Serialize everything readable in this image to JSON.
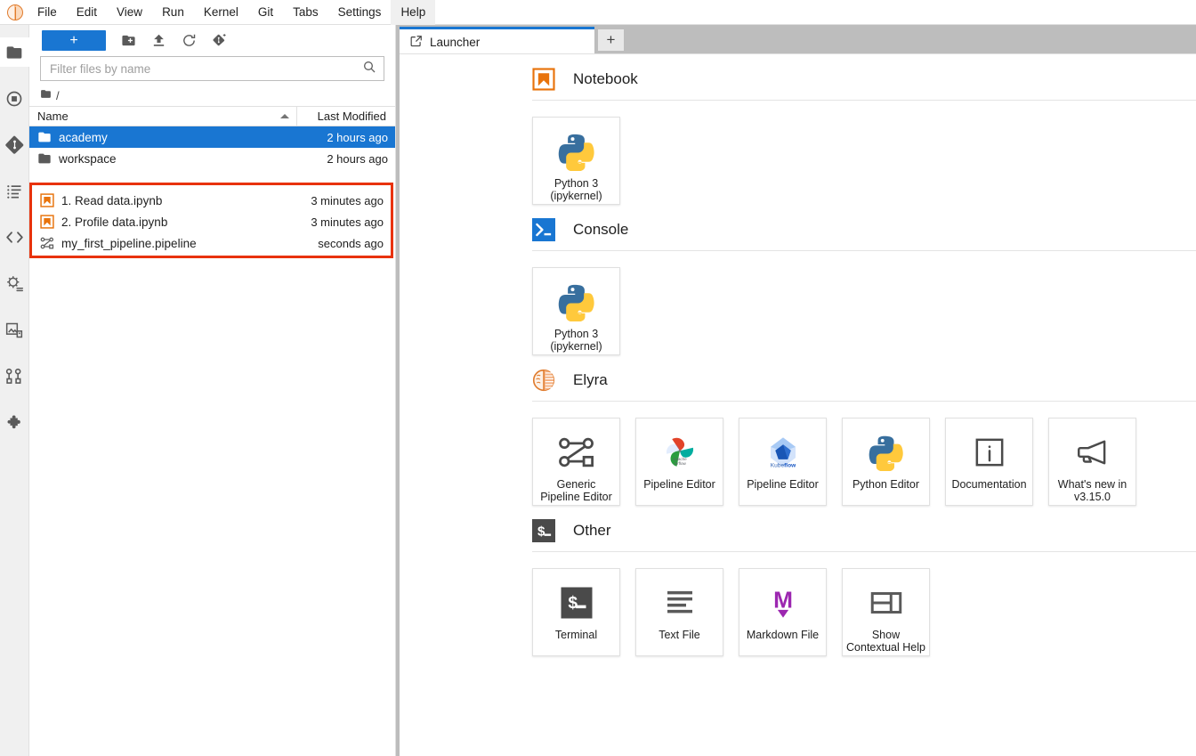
{
  "menubar": {
    "logo_name": "elyra-logo",
    "items": [
      {
        "label": "File",
        "active": false
      },
      {
        "label": "Edit",
        "active": false
      },
      {
        "label": "View",
        "active": false
      },
      {
        "label": "Run",
        "active": false
      },
      {
        "label": "Kernel",
        "active": false
      },
      {
        "label": "Git",
        "active": false
      },
      {
        "label": "Tabs",
        "active": false
      },
      {
        "label": "Settings",
        "active": false
      },
      {
        "label": "Help",
        "active": true
      }
    ]
  },
  "activitybar": {
    "items": [
      {
        "name": "file-browser-icon",
        "selected": true
      },
      {
        "name": "running-terminals-and-kernels-icon",
        "selected": false
      },
      {
        "name": "git-icon",
        "selected": false
      },
      {
        "name": "table-of-contents-icon",
        "selected": false
      },
      {
        "name": "code-snippets-icon",
        "selected": false
      },
      {
        "name": "runtimes-icon",
        "selected": false
      },
      {
        "name": "runtime-images-icon",
        "selected": false
      },
      {
        "name": "component-catalogs-icon",
        "selected": false
      },
      {
        "name": "extension-manager-icon",
        "selected": false
      }
    ]
  },
  "filebrowser": {
    "new_launcher_label": "+",
    "toolbar_icons": [
      "new-folder-icon",
      "upload-icon",
      "refresh-icon",
      "new-git-branch-icon"
    ],
    "filter": {
      "placeholder": "Filter files by name",
      "value": ""
    },
    "breadcrumb": "/",
    "columns": {
      "name": "Name",
      "last_modified": "Last Modified"
    },
    "sort_direction": "ascending",
    "rows": [
      {
        "icon": "folder-icon",
        "name": "academy",
        "modified": "2 hours ago",
        "selected": true
      },
      {
        "icon": "folder-icon",
        "name": "workspace",
        "modified": "2 hours ago",
        "selected": false
      },
      {
        "icon": "notebook-icon",
        "name": "1. Read data.ipynb",
        "modified": "3 minutes ago",
        "selected": false
      },
      {
        "icon": "notebook-icon",
        "name": "2. Profile data.ipynb",
        "modified": "3 minutes ago",
        "selected": false
      },
      {
        "icon": "pipeline-icon",
        "name": "my_first_pipeline.pipeline",
        "modified": "seconds ago",
        "selected": false
      }
    ],
    "highlight_color": "#e8320c"
  },
  "main": {
    "tabs": [
      {
        "label": "Launcher",
        "icon": "launcher-icon",
        "active": true
      }
    ],
    "new_tab_label": "+",
    "sections": [
      {
        "title": "Notebook",
        "icon": "notebook-section-icon",
        "cards": [
          {
            "label": "Python 3\n(ipykernel)",
            "icon": "python-logo-icon"
          }
        ]
      },
      {
        "title": "Console",
        "icon": "console-section-icon",
        "cards": [
          {
            "label": "Python 3\n(ipykernel)",
            "icon": "python-logo-icon"
          }
        ]
      },
      {
        "title": "Elyra",
        "icon": "elyra-section-icon",
        "cards": [
          {
            "label": "Generic Pipeline Editor",
            "icon": "generic-pipeline-icon"
          },
          {
            "label": "Pipeline Editor",
            "icon": "apache-airflow-icon"
          },
          {
            "label": "Pipeline Editor",
            "icon": "kubeflow-icon"
          },
          {
            "label": "Python Editor",
            "icon": "python-logo-icon"
          },
          {
            "label": "Documentation",
            "icon": "info-icon"
          },
          {
            "label": "What's new in v3.15.0",
            "icon": "megaphone-icon"
          }
        ]
      },
      {
        "title": "Other",
        "icon": "terminal-section-icon",
        "cards": [
          {
            "label": "Terminal",
            "icon": "terminal-icon"
          },
          {
            "label": "Text File",
            "icon": "text-file-icon"
          },
          {
            "label": "Markdown File",
            "icon": "markdown-icon"
          },
          {
            "label": "Show Contextual Help",
            "icon": "contextual-help-icon"
          }
        ]
      }
    ]
  },
  "colors": {
    "accent": "#1976d2",
    "notebook_orange": "#e8730c",
    "highlight_red": "#e8320c",
    "markdown_purple": "#9c27b0"
  }
}
